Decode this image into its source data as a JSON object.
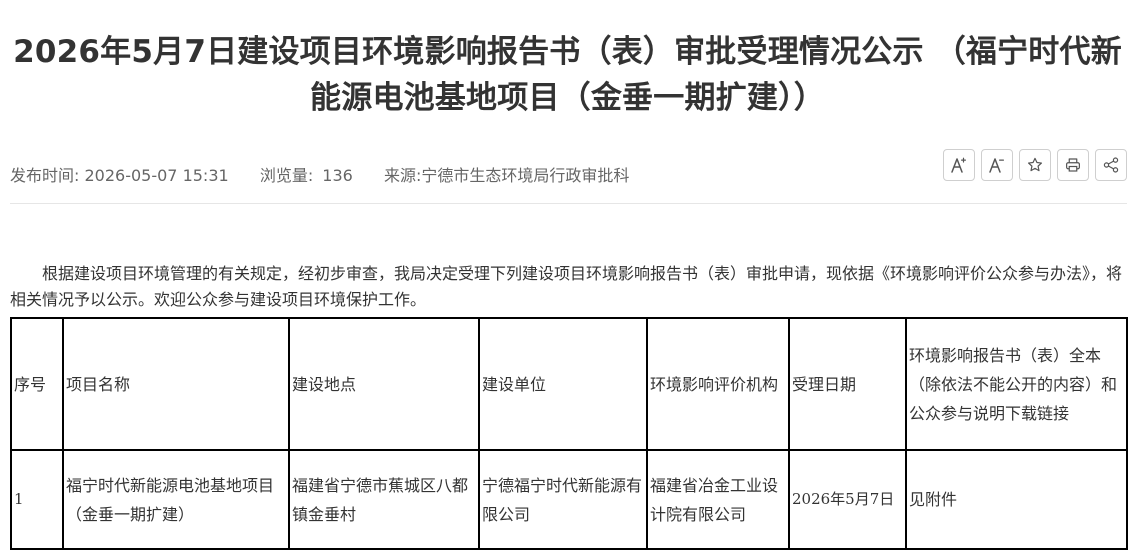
{
  "article": {
    "title": "2026年5月7日建设项目环境影响报告书（表）审批受理情况公示 （福宁时代新能源电池基地项目（金垂一期扩建））",
    "publish_label": "发布时间:",
    "publish_time": "2026-05-07 15:31",
    "views_label": "浏览量:",
    "views_count": "136",
    "source_label": "来源:",
    "source": "宁德市生态环境局行政审批科",
    "intro": "根据建设项目环境管理的有关规定，经初步审查，我局决定受理下列建设项目环境影响报告书（表）审批申请，现依据《环境影响评价公众参与办法》，将相关情况予以公示。欢迎公众参与建设项目环境保护工作。"
  },
  "toolbar": {
    "font_increase_icon": "font-increase-icon",
    "font_decrease_icon": "font-decrease-icon",
    "favorite_icon": "star-icon",
    "print_icon": "print-icon",
    "share_icon": "share-icon"
  },
  "table": {
    "headers": [
      "序号",
      "项目名称",
      "建设地点",
      "建设单位",
      "环境影响评价机构",
      "受理日期",
      "环境影响报告书（表）全本（除依法不能公开的内容）和公众参与说明下载链接"
    ],
    "rows": [
      {
        "no": "1",
        "project": "福宁时代新能源电池基地项目（金垂一期扩建）",
        "site": "福建省宁德市蕉城区八都镇金垂村",
        "unit": "宁德福宁时代新能源有限公司",
        "org": "福建省冶金工业设计院有限公司",
        "date": "2026年5月7日",
        "link": "见附件"
      }
    ]
  },
  "colors": {
    "text": "#333333",
    "meta": "#666666",
    "border": "#000000",
    "divider": "#e6e6e6"
  }
}
